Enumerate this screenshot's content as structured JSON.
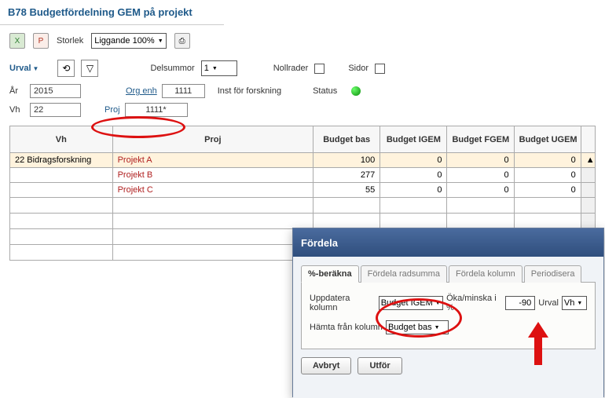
{
  "title": "B78 Budgetfördelning GEM på projekt",
  "toolbar": {
    "excel_icon": "X",
    "pdf_icon": "P",
    "storlek_label": "Storlek",
    "storlek_value": "Liggande 100%",
    "print_icon": "⎙"
  },
  "filterbar": {
    "urval_label": "Urval",
    "refresh_icon": "⟲",
    "filter_icon": "▽",
    "delsummor_label": "Delsummor",
    "delsummor_value": "1",
    "nollrader_label": "Nollrader",
    "sidor_label": "Sidor"
  },
  "criteria": {
    "ar_label": "År",
    "ar_value": "2015",
    "orgenh_label": "Org enh",
    "orgenh_value": "1111",
    "orgenh_desc": "Inst för forskning",
    "status_label": "Status",
    "vh_label": "Vh",
    "vh_value": "22",
    "proj_label": "Proj",
    "proj_value": "1111*"
  },
  "table": {
    "headers": {
      "vh": "Vh",
      "proj": "Proj",
      "budget_bas": "Budget bas",
      "budget_igem": "Budget IGEM",
      "budget_fgem": "Budget FGEM",
      "budget_ugem": "Budget UGEM"
    },
    "rows": [
      {
        "vh": "22 Bidragsforskning",
        "proj": "Projekt A",
        "bas": "100",
        "igem": "0",
        "fgem": "0",
        "ugem": "0",
        "hl": true
      },
      {
        "vh": "",
        "proj": "Projekt B",
        "bas": "277",
        "igem": "0",
        "fgem": "0",
        "ugem": "0",
        "hl": false
      },
      {
        "vh": "",
        "proj": "Projekt C",
        "bas": "55",
        "igem": "0",
        "fgem": "0",
        "ugem": "0",
        "hl": false
      }
    ],
    "scroll_up": "▲"
  },
  "dialog": {
    "title": "Fördela",
    "tabs": {
      "pct": "%-beräkna",
      "radsumma": "Fördela radsumma",
      "kolumn": "Fördela kolumn",
      "periodisera": "Periodisera"
    },
    "uppdatera_label": "Uppdatera kolumn",
    "uppdatera_value": "Budget IGEM",
    "oka_label": "Öka/minska i %",
    "oka_value": "-90",
    "urval_label": "Urval",
    "urval_value": "Vh",
    "hamta_label": "Hämta från kolumn",
    "hamta_value": "Budget bas",
    "avbryt": "Avbryt",
    "utfor": "Utför"
  }
}
